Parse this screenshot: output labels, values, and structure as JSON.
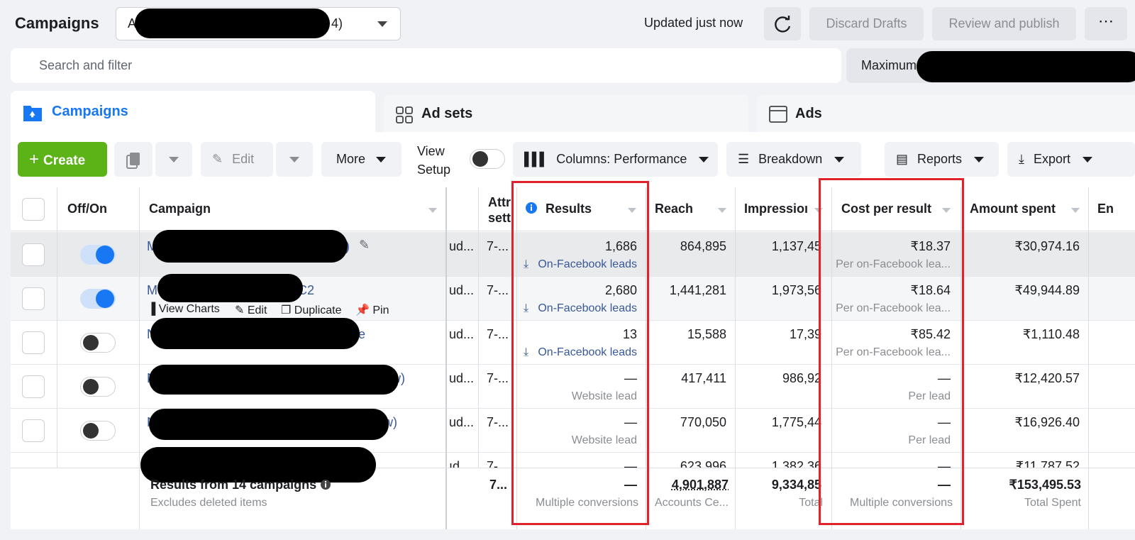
{
  "header": {
    "title": "Campaigns",
    "account_select_prefix": "A",
    "account_select_suffix": "4)",
    "updated": "Updated just now",
    "discard": "Discard Drafts",
    "review": "Review and publish",
    "more": "⋯"
  },
  "search": {
    "placeholder": "Search and filter",
    "max_prefix": "Maximum"
  },
  "tabs": [
    {
      "label": "Campaigns"
    },
    {
      "label": "Ad sets"
    },
    {
      "label": "Ads"
    }
  ],
  "toolbar": {
    "create": "Create",
    "edit": "Edit",
    "more": "More",
    "view_setup_1": "View",
    "view_setup_2": "Setup",
    "columns": "Columns: Performance",
    "breakdown": "Breakdown",
    "reports": "Reports",
    "export": "Export"
  },
  "columns": {
    "offon": "Off/On",
    "campaign": "Campaign",
    "attr1": "Attr",
    "attr2": "sett",
    "results": "Results",
    "reach": "Reach",
    "impressions": "Impressioı",
    "cost": "Cost per result",
    "amount": "Amount spent",
    "end": "En"
  },
  "rows": [
    {
      "name_prefix": "M",
      "name_suffix": "y)",
      "bid": "ud...",
      "attr": "7-...",
      "results": "1,686",
      "result_type": "On-Facebook leads",
      "reach": "864,895",
      "impressions": "1,137,45",
      "cost": "₹18.37",
      "cost_type": "Per on-Facebook lea...",
      "amount": "₹30,974.16",
      "on": true
    },
    {
      "name_prefix": "M",
      "name_suffix": "C2",
      "bid": "ud...",
      "attr": "7-...",
      "results": "2,680",
      "result_type": "On-Facebook leads",
      "reach": "1,441,281",
      "impressions": "1,973,56",
      "cost": "₹18.64",
      "cost_type": "Per on-Facebook lea...",
      "amount": "₹49,944.89",
      "on": true
    },
    {
      "name_prefix": "N",
      "name_suffix": "e",
      "bid": "ud...",
      "attr": "7-...",
      "results": "13",
      "result_type": "On-Facebook leads",
      "reach": "15,588",
      "impressions": "17,39",
      "cost": "₹85.42",
      "cost_type": "Per on-Facebook lea...",
      "amount": "₹1,110.48",
      "on": false
    },
    {
      "name_prefix": "N",
      "name_suffix": "w)",
      "bid": "ud...",
      "attr": "7-...",
      "results": "—",
      "result_type": "Website lead",
      "reach": "417,411",
      "impressions": "986,92",
      "cost": "—",
      "cost_type": "Per lead",
      "amount": "₹12,420.57",
      "on": false
    },
    {
      "name_prefix": "N",
      "name_suffix": "w)",
      "bid": "ud...",
      "attr": "7-...",
      "results": "—",
      "result_type": "Website lead",
      "reach": "770,050",
      "impressions": "1,775,44",
      "cost": "—",
      "cost_type": "Per lead",
      "amount": "₹16,926.40",
      "on": false
    },
    {
      "name_prefix": "",
      "name_suffix": "",
      "bid": "ıd",
      "attr": "7-",
      "results": "—",
      "result_type": "",
      "reach": "623,996",
      "impressions": "1,382,36",
      "cost": "—",
      "cost_type": "",
      "amount": "₹11,787.52",
      "on": false
    }
  ],
  "row_actions": {
    "charts": "View Charts",
    "edit": "Edit",
    "duplicate": "Duplicate",
    "pin": "Pin"
  },
  "footer": {
    "label": "Results from 14 campaigns",
    "sub": "Excludes deleted items",
    "attr": "7...",
    "results": "—",
    "results_sub": "Multiple conversions",
    "reach": "4,901,887",
    "reach_sub": "Accounts Ce...",
    "impressions": "9,334,85",
    "impressions_sub": "Total",
    "cost": "—",
    "cost_sub": "Multiple conversions",
    "amount": "₹153,495.53",
    "amount_sub": "Total Spent"
  },
  "colors": {
    "create": "#5bb318",
    "brand": "#1877f2",
    "highlight": "#e0232b"
  }
}
